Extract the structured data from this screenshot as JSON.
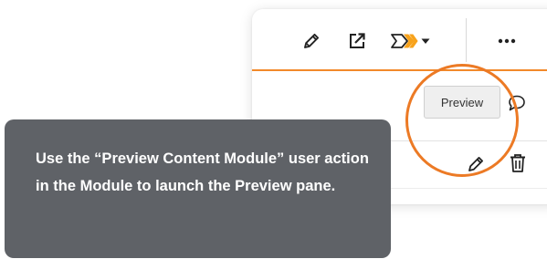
{
  "toolbar": {
    "icons": {
      "edit": "pencil-icon",
      "open_external": "external-link-icon",
      "workflow": "workflow-chevrons-icon",
      "dropdown": "caret-down-icon",
      "more": "more-dots-icon"
    },
    "more_label": "•••"
  },
  "preview_row": {
    "preview_button_label": "Preview",
    "comment_icon": "speech-bubble-icon"
  },
  "actions_row": {
    "edit_icon": "pencil-icon",
    "delete_icon": "trash-icon"
  },
  "tooltip": {
    "text": "Use the “Preview Content Module” user action in the Module to launch the Preview pane."
  },
  "colors": {
    "accent_orange": "#f2892a",
    "highlight_circle": "#ec7a25",
    "tooltip_background": "#5f6267",
    "workflow_icon_fill": "#f7a21b"
  }
}
